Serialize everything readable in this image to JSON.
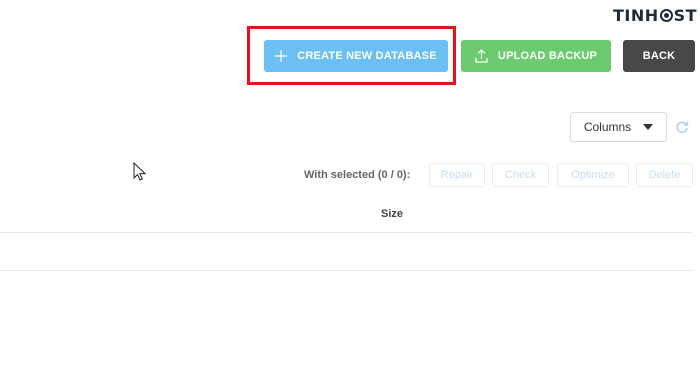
{
  "brand": {
    "logo_text_1": "TIN",
    "logo_text_2": "H",
    "logo_text_3": "ST"
  },
  "toolbar": {
    "create_label": "CREATE NEW DATABASE",
    "upload_label": "UPLOAD BACKUP",
    "back_label": "BACK"
  },
  "table_controls": {
    "columns_label": "Columns",
    "with_selected_label": "With selected (0 / 0):",
    "bulk_actions": [
      "Repair",
      "Check",
      "Optimize",
      "Delete"
    ]
  },
  "table": {
    "headers": [
      "Size"
    ]
  },
  "icons": {
    "create": "plus-icon",
    "upload": "upload-icon",
    "columns": "caret-down-icon",
    "refresh": "refresh-icon",
    "cursor": "mouse-pointer-icon"
  },
  "colors": {
    "create_button": "#6bbff2",
    "upload_button": "#6ccb71",
    "back_button": "#484848",
    "highlight": "#e8111a"
  }
}
